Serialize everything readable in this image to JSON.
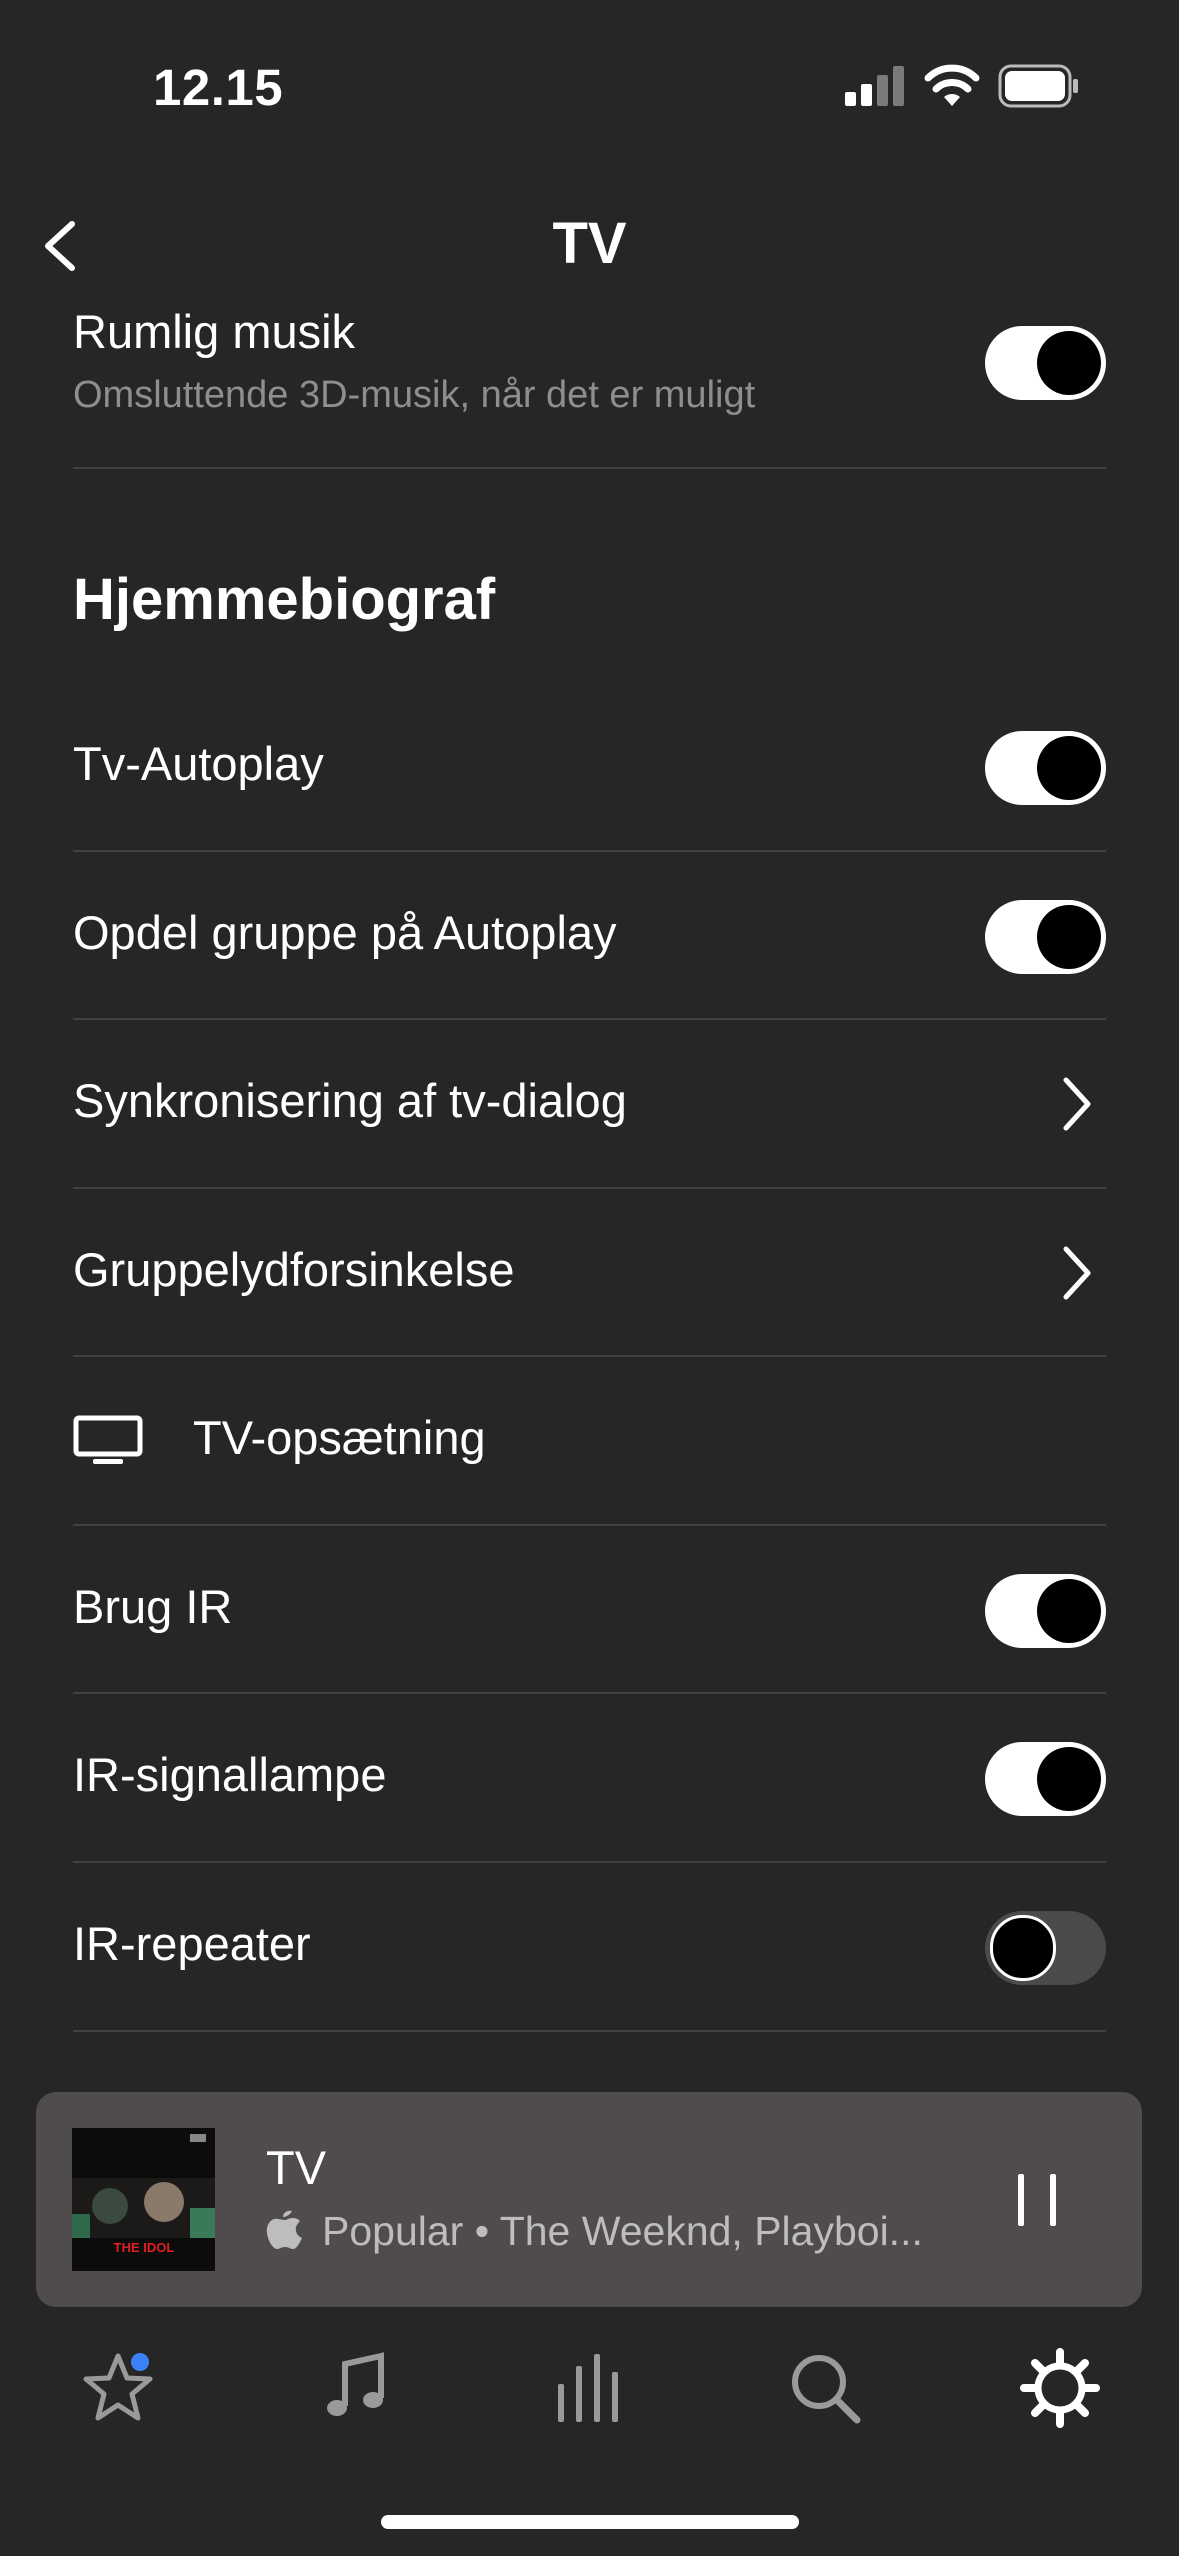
{
  "status_bar": {
    "time": "12.15"
  },
  "nav": {
    "title": "TV"
  },
  "spatial": {
    "label": "Rumlig musik",
    "sublabel": "Omsluttende 3D-musik, når det er muligt",
    "on": true
  },
  "section": {
    "heading": "Hjemmebiograf"
  },
  "rows": {
    "tv_autoplay": {
      "label": "Tv-Autoplay",
      "on": true
    },
    "split_group": {
      "label": "Opdel gruppe på Autoplay",
      "on": true
    },
    "dialog_sync": {
      "label": "Synkronisering af tv-dialog"
    },
    "group_delay": {
      "label": "Gruppelydforsinkelse"
    },
    "tv_setup": {
      "label": "TV-opsætning",
      "icon": "tv-icon"
    },
    "use_ir": {
      "label": "Brug IR",
      "on": true
    },
    "ir_lamp": {
      "label": "IR-signallampe",
      "on": true
    },
    "ir_repeater": {
      "label": "IR-repeater",
      "on": false
    }
  },
  "now_playing": {
    "title": "TV",
    "subtitle": "Popular • The Weeknd, Playboi...",
    "album_text": "THE IDOL"
  },
  "tabs": [
    {
      "name": "favorites",
      "icon": "star-icon",
      "badge": true
    },
    {
      "name": "music",
      "icon": "music-note-icon"
    },
    {
      "name": "system",
      "icon": "bars-icon"
    },
    {
      "name": "search",
      "icon": "search-icon"
    },
    {
      "name": "settings",
      "icon": "gear-icon",
      "active": true
    }
  ],
  "colors": {
    "background": "#262626",
    "divider": "#414141",
    "player": "#504b4d",
    "badge": "#3b82f6"
  }
}
